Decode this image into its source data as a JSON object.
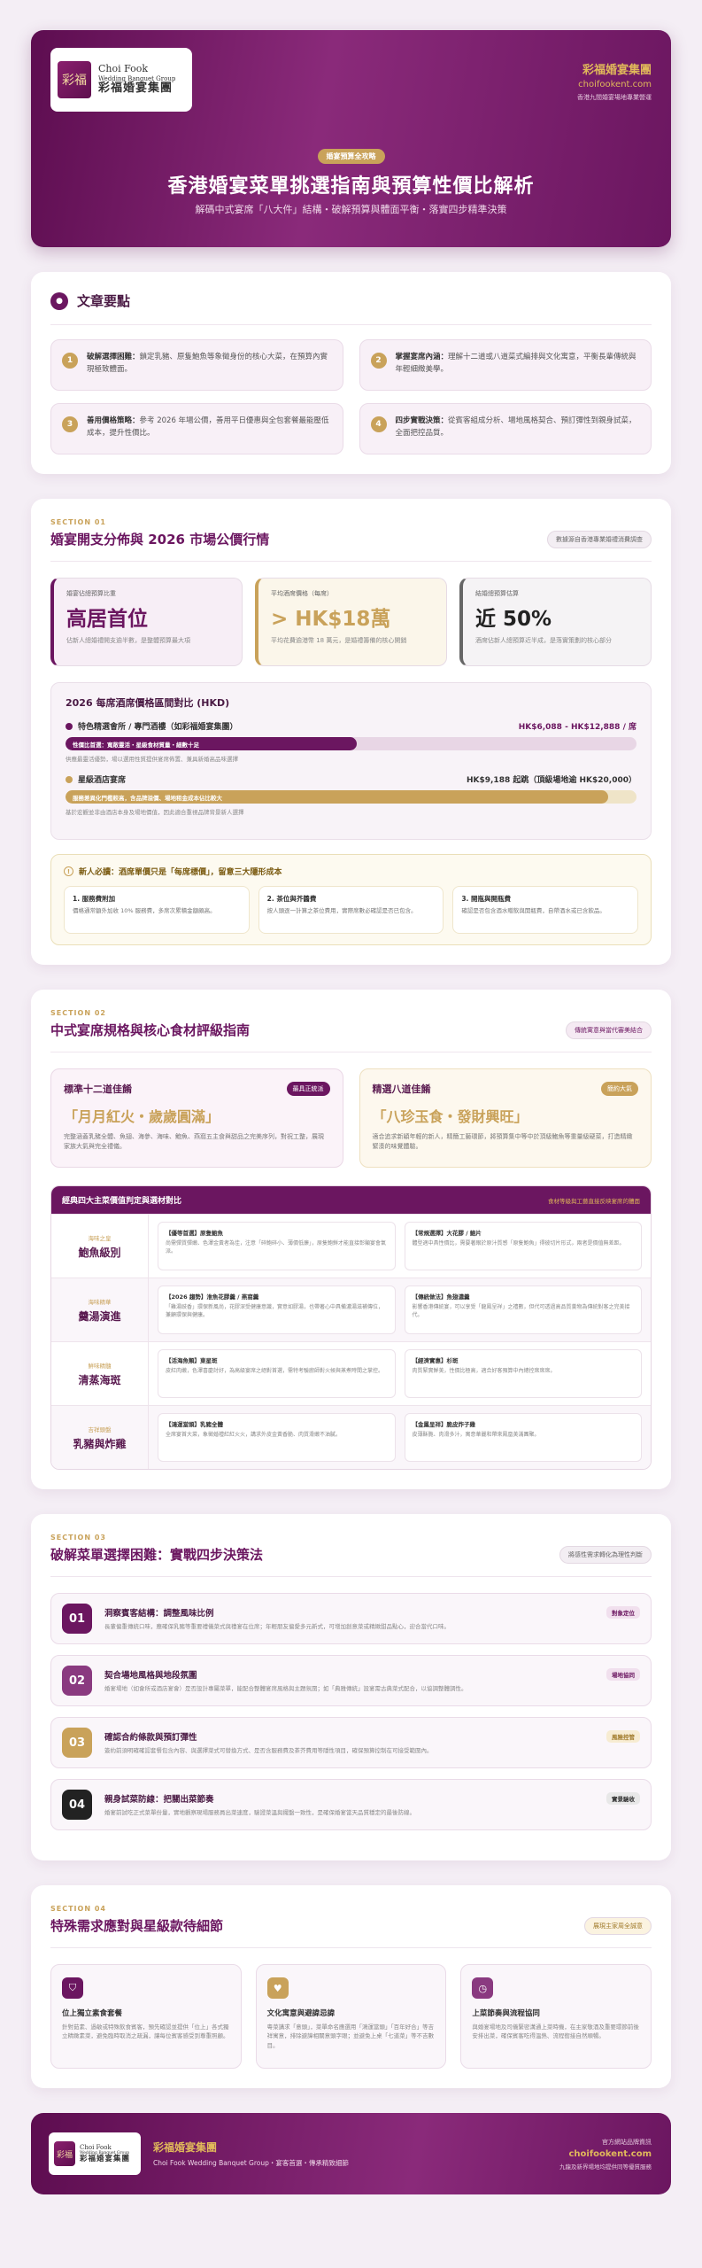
{
  "header": {
    "logo_en": "Choi Fook",
    "logo_en2": "Wedding Banquet Group",
    "logo_zh": "彩福婚宴集團",
    "logo_mark": "彩福",
    "brand": "彩福婚宴集團",
    "site": "choifookent.com",
    "sub": "香港九間婚宴場地專業營運",
    "badge": "婚宴預算全攻略",
    "title": "香港婚宴菜單挑選指南與預算性價比解析",
    "subtitle": "解碼中式宴席「八大件」結構・破解預算與體面平衡・落實四步精準決策"
  },
  "summary": {
    "title": "文章要點",
    "items": [
      {
        "num": "1",
        "bold": "破解選擇困難：",
        "text": "鎖定乳豬、原隻鮑魚等象徵身份的核心大菜，在預算內實現極致體面。"
      },
      {
        "num": "2",
        "bold": "掌握宴席內涵：",
        "text": "理解十二道或八道菜式編排與文化寓意，平衡長輩傳統與年輕細緻美學。"
      },
      {
        "num": "3",
        "bold": "善用價格策略：",
        "text": "參考 2026 年場公價，善用平日優惠與全包套餐最能壓低成本，提升性價比。"
      },
      {
        "num": "4",
        "bold": "四步實戰決策：",
        "text": "從賓客組成分析、場地風格契合、預訂彈性到親身試菜，全面把控品質。"
      }
    ]
  },
  "s1": {
    "tag": "SECTION 01",
    "title": "婚宴開支分佈與 2026 市場公價行情",
    "note": "數據源自香港專業婚禮消費調查",
    "stats": [
      {
        "label": "婚宴佔總預算比重",
        "value": "高居首位",
        "desc": "佔新人總婚禮開支逾半數，是整體預算最大項"
      },
      {
        "label": "平均酒席價格（每席）",
        "value": "> HK$18萬",
        "desc": "平均花費逾港幣 18 萬元，是婚禮籌備的核心開銷"
      },
      {
        "label": "結婚總預算估算",
        "value": "近 50%",
        "desc": "酒席佔新人總預算近半成，是落實策劃的核心部分"
      }
    ],
    "chart_title": "2026 每席酒席價格區間對比 (HKD)",
    "bars": [
      {
        "label": "特色精選會所 / 專門酒樓（如彩福婚宴集團）",
        "value": "HK$6,088 - HK$12,888 / 席",
        "fill_text": "性價比首選：寬敞靈活・星級食材質量・細數十足",
        "note": "供應最靈活優勢，場以選用性質提供宴席佈置、兼具新婚高品味選擇",
        "pct": 0.51
      },
      {
        "label": "星級酒店宴席",
        "value": "HK$9,188 起跳（頂級場地逾 HK$20,000）",
        "fill_text": "服務差異化門檻較高，含品牌溢價、場地租金成本佔比較大",
        "note": "基於宏觀並非由酒店本身及場地價值，因此適合重視品牌背景新人選擇",
        "pct": 0.95
      }
    ],
    "warn_title": "新人必讀：酒席單價只是「每席標價」，留意三大隱形成本",
    "warns": [
      {
        "title": "1. 服務費附加",
        "text": "價格通常額外加收 10% 服務費，多席次累積金額頗高。"
      },
      {
        "title": "2. 茶位與芥醬費",
        "text": "按人頭逐一計算之茶位費用，實際席數必確認是否已包含。"
      },
      {
        "title": "3. 開瓶與開瓶費",
        "text": "確認是否包含酒水贈飲與開瓶費，自帶酒水或已含飲品。"
      }
    ]
  },
  "s2": {
    "tag": "SECTION 02",
    "title": "中式宴席規格與核心食材評級指南",
    "note": "傳統寓意與當代審美結合",
    "menus": [
      {
        "name": "標準十二道佳餚",
        "pill": "最具正統派",
        "quote": "「月月紅火・歲歲圓滿」",
        "desc": "完整涵蓋乳豬全體、魚翅、海參、海味、鮑魚、燕窩五主食與甜品之完美序列，對祝工整，展現家族大氣與完全禮儀。"
      },
      {
        "name": "精選八道佳餚",
        "pill": "簡約大氣",
        "quote": "「八珍玉食・發財興旺」",
        "desc": "適合追求新穎年輕的新人，精簡工藝環節，將預算集中等中於頂級鮑魚等重量級硬菜，打造精緻緊湊的味覺體驗。"
      }
    ],
    "table_title": "經典四大主菜價值判定與選材對比",
    "table_right": "食材等級與工藝直接反映宴席的體面",
    "rows": [
      {
        "sub": "海味之皇",
        "name": "鮑魚級別",
        "cells": [
          {
            "t": "【優等首選】原隻鮑魚",
            "p": "尚需彈質彈嫩、色澤金黃者為佳，注意「碎鮑碎小、薄價低廉」，原隻鮑鮮才能直接彰顯宴會氣派。"
          },
          {
            "t": "【常規選擇】大花膠 / 鮑片",
            "p": "體型適中具性價比，需要著眼於原汁質感「原隻鮑魚」得彼切片形式，兩者是價值無差距。"
          }
        ]
      },
      {
        "sub": "海味精華",
        "name": "羹湯演進",
        "cells": [
          {
            "t": "【2026 趨勢】淮魚花膠羹 / 燕窩羹",
            "p": "「雞湯豉香」環保新風尚，花膠深受健康意識，實意如膠湯，也帶著心中具備濃湯滋補傳位，兼顧環保與健康。"
          },
          {
            "t": "【傳統做法】魚翅濃羹",
            "p": "影響香港傳統宴，可以享受「龍鳳呈祥」之禮數，但代可透過高品質羹物為傳統對客之完美接代。"
          }
        ]
      },
      {
        "sub": "鮮味精髓",
        "name": "清蒸海斑",
        "cells": [
          {
            "t": "【活海魚類】東星斑",
            "p": "皮紅肉嫩，色澤喜慶討好，為高級宴席之絕對首選，需特考驗廚師對火候與蒸煮時間之掌控。"
          },
          {
            "t": "【經濟實惠】杉斑",
            "p": "肉質緊實鮮美，性價比極高，適合好客預算中內總控席席席。"
          }
        ]
      },
      {
        "sub": "吉祥頭盤",
        "name": "乳豬與炸雞",
        "cells": [
          {
            "t": "【鴻運當頭】乳豬全體",
            "p": "全席宴首大菜，象徵婚禮紅紅火火，講求外皮金黃香脆、肉質滑嫩不油膩。"
          },
          {
            "t": "【金鳳呈祥】脆皮炸子雞",
            "p": "皮薄酥脆、肉滑多汁，寓意華麗和帶來鳳凰美滿團聚。"
          }
        ]
      }
    ]
  },
  "s3": {
    "tag": "SECTION 03",
    "title": "破解菜單選擇困難：實戰四步決策法",
    "note": "將感性需求轉化為理性判斷",
    "steps": [
      {
        "num": "01",
        "title": "洞察賓客結構：調整風味比例",
        "tag": "對象定位",
        "desc": "長輩偏重傳統口味，應確保乳豬等重要禮儀菜式與禮宴在位席；年輕朋友偏愛多元新式，可增加創意菜或精緻甜品點心，迎合當代口味。"
      },
      {
        "num": "02",
        "title": "契合場地風格與地段氛圍",
        "tag": "場地協同",
        "desc": "婚宴場地（如會所或酒店宴會）是否設計專屬菜單，能配合整體宴席風格與主題氛圍；如「典雅傳統」設宴需古典菜式配合，以協調整體調性。"
      },
      {
        "num": "03",
        "title": "確認合約條款與預訂彈性",
        "tag": "風險控管",
        "desc": "簽約前須明確確認套餐包含內容、與選擇菜式可替換方式、是否含服務費及茶芥費用等隱性項目，確保預算控制在可接受範圍內。"
      },
      {
        "num": "04",
        "title": "親身試菜防線：把關出菜節奏",
        "tag": "實景驗收",
        "desc": "婚宴前試吃正式菜單份量，實地觀察現場服務員出菜速度，驗證菜溫與擺盤一致性，是確保婚宴當天品質穩定的最後防線。"
      }
    ]
  },
  "s4": {
    "tag": "SECTION 04",
    "title": "特殊需求應對與星級款待細節",
    "note": "展現主家周全誠意",
    "items": [
      {
        "title": "位上獨立素食套餐",
        "desc": "針對茹素、過敏或特殊飲食賓客，預先確認並提供「位上」各式獨立精緻素菜，避免臨時取消之疏漏，讓每位賓客感受到尊重照顧。"
      },
      {
        "title": "文化寓意與避諱忌諱",
        "desc": "粵菜講求「意頭」，菜單命名應選用「鴻運當頭」「百年好合」等吉祥寓意，排除避諱相關意頭字眼；並避免上桌「七道菜」等不吉數目。"
      },
      {
        "title": "上菜節奏與流程協同",
        "desc": "與婚宴場地及司儀緊密溝通上菜時機，在主家敬酒及重要環節前後安排出菜，確保賓客吃得溫熱、流程銜接自然順暢。"
      }
    ]
  },
  "footer": {
    "brand": "彩福婚宴集團",
    "tag": "Choi Fook Wedding Banquet Group・宴客首選・傳承精致細節",
    "r1": "官方網站品牌資訊",
    "r2": "choifookent.com",
    "r3": "九龍及新界場地均提供同等優質服務"
  },
  "colors": {
    "primary": "#6b1660",
    "gold": "#c9a25a",
    "dark": "#222222"
  }
}
